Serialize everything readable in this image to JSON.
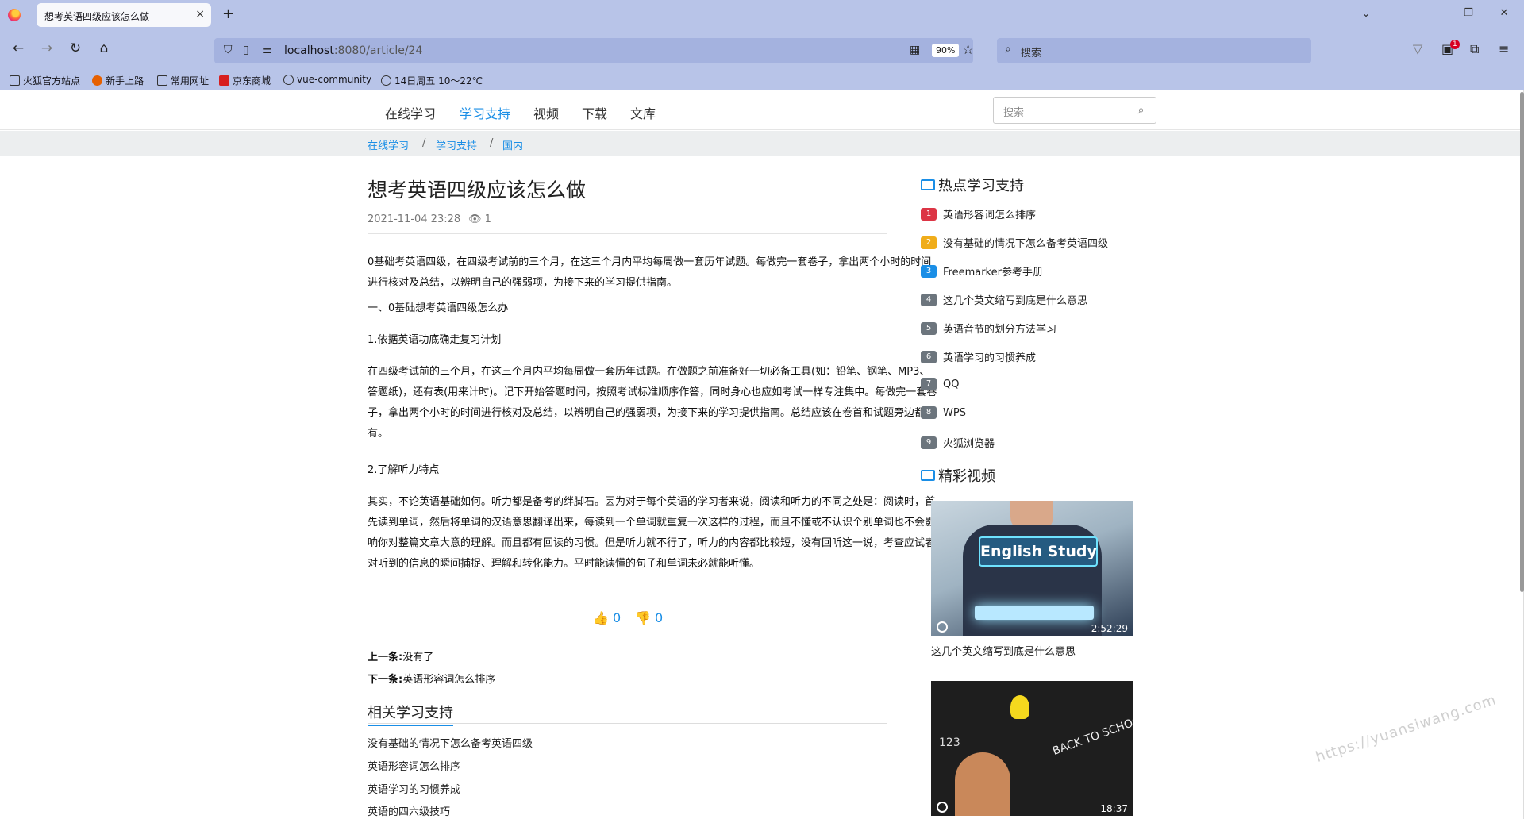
{
  "browser": {
    "tab_title": "想考英语四级应该怎么做",
    "tab_close": "×",
    "new_tab": "+",
    "list_all": "⌄",
    "url_host": "localhost",
    "url_rest": ":8080/article/24",
    "zoom": "90%",
    "search_placeholder": "搜索",
    "window_buttons": [
      "–",
      "❐",
      "✕"
    ],
    "extension_badge": "1",
    "bookmarks": [
      {
        "label": "火狐官方站点",
        "color": "#e2812a"
      },
      {
        "label": "新手上路",
        "color": "#e66000"
      },
      {
        "label": "常用网址",
        "color": "#444444"
      },
      {
        "label": "京东商城",
        "color": "#d71f1f"
      },
      {
        "label": "vue-community",
        "color": "#333333"
      },
      {
        "label": "14日周五 10～22℃",
        "color": "#333333"
      }
    ]
  },
  "site": {
    "nav": [
      "在线学习",
      "学习支持",
      "视频",
      "下载",
      "文库"
    ],
    "active_nav": "学习支持",
    "search_placeholder": "搜索",
    "search_button": "⌕",
    "breadcrumbs": [
      "在线学习",
      "学习支持",
      "国内"
    ],
    "breadcrumb_sep": "/"
  },
  "article": {
    "title": "想考英语四级应该怎么做",
    "datetime": "2021-11-04 23:28",
    "views": "1",
    "views_icon": "👁",
    "paragraphs": [
      "0基础考英语四级，在四级考试前的三个月，在这三个月内平均每周做一套历年试题。每做完一套卷子，拿出两个小时的时间进行核对及总结，以辨明自己的强弱项，为接下来的学习提供指南。",
      "一、0基础想考英语四级怎么办",
      "1.依据英语功底确走复习计划",
      "在四级考试前的三个月，在这三个月内平均每周做一套历年试题。在做题之前准备好一切必备工具(如：铅笔、钢笔、MP3、答题纸)，还有表(用来计时)。记下开始答题时间，按照考试标准顺序作答，同时身心也应如考试一样专注集中。每做完一套卷子，拿出两个小时的时间进行核对及总结，以辨明自己的强弱项，为接下来的学习提供指南。总结应该在卷首和试题旁边都有。",
      "2.了解听力特点",
      "其实，不论英语基础如何。听力都是备考的绊脚石。因为对于每个英语的学习者来说，阅读和听力的不同之处是：阅读时，首先读到单词，然后将单词的汉语意思翻译出来，每读到一个单词就重复一次这样的过程，而且不懂或不认识个别单词也不会影响你对整篇文章大意的理解。而且都有回读的习惯。但是听力就不行了，听力的内容都比较短，没有回听这一说，考查应试者对听到的信息的瞬间捕捉、理解和转化能力。平时能读懂的句子和单词未必就能听懂。"
    ],
    "like_count": "0",
    "dislike_count": "0",
    "like_icon": "👍",
    "dislike_icon": "👎",
    "prev_label": "上一条:",
    "prev_value": "没有了",
    "next_label": "下一条:",
    "next_value": "英语形容词怎么排序",
    "related_title": "相关学习支持",
    "related": [
      "没有基础的情况下怎么备考英语四级",
      "英语形容词怎么排序",
      "英语学习的习惯养成",
      "英语的四六级技巧"
    ]
  },
  "sidebar": {
    "hot_title": "热点学习支持",
    "hot": [
      {
        "num": "1",
        "title": "英语形容词怎么排序",
        "color": "#dc3545"
      },
      {
        "num": "2",
        "title": "没有基础的情况下怎么备考英语四级",
        "color": "#f0ad1a"
      },
      {
        "num": "3",
        "title": "Freemarker参考手册",
        "color": "#1a8ee6"
      },
      {
        "num": "4",
        "title": "这几个英文缩写到底是什么意思",
        "color": "#6c757d"
      },
      {
        "num": "5",
        "title": "英语音节的划分方法学习",
        "color": "#6c757d"
      },
      {
        "num": "6",
        "title": "英语学习的习惯养成",
        "color": "#6c757d"
      },
      {
        "num": "7",
        "title": "QQ",
        "color": "#6c757d"
      },
      {
        "num": "8",
        "title": "WPS",
        "color": "#6c757d"
      },
      {
        "num": "9",
        "title": "火狐浏览器",
        "color": "#6c757d"
      }
    ],
    "video_title": "精彩视频",
    "videos": [
      {
        "duration": "2:52:29",
        "caption": "这几个英文缩写到底是什么意思",
        "overlay": "English Study"
      },
      {
        "duration": "18:37",
        "caption": "",
        "overlay": "BACK TO SCHOOL"
      }
    ]
  },
  "watermark": "https://yuansiwang.com"
}
